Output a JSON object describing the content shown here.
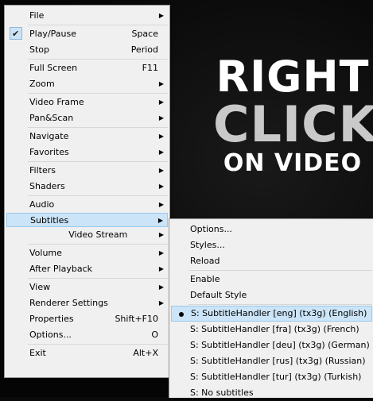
{
  "overlay": {
    "line1": "RIGHT",
    "line2": "CLICK",
    "line3": "ON VIDEO"
  },
  "main_menu": {
    "groups": [
      [
        {
          "label": "File",
          "submenu": true
        }
      ],
      [
        {
          "label": "Play/Pause",
          "shortcut": "Space",
          "checked": true
        },
        {
          "label": "Stop",
          "shortcut": "Period"
        }
      ],
      [
        {
          "label": "Full Screen",
          "shortcut": "F11"
        },
        {
          "label": "Zoom",
          "submenu": true
        }
      ],
      [
        {
          "label": "Video Frame",
          "submenu": true
        },
        {
          "label": "Pan&Scan",
          "submenu": true
        }
      ],
      [
        {
          "label": "Navigate",
          "submenu": true
        },
        {
          "label": "Favorites",
          "submenu": true
        }
      ],
      [
        {
          "label": "Filters",
          "submenu": true
        },
        {
          "label": "Shaders",
          "submenu": true
        }
      ],
      [
        {
          "label": "Audio",
          "submenu": true
        },
        {
          "label": "Subtitles",
          "submenu": true,
          "active": true
        },
        {
          "label": "Video Stream",
          "submenu": true
        }
      ],
      [
        {
          "label": "Volume",
          "submenu": true
        },
        {
          "label": "After Playback",
          "submenu": true
        }
      ],
      [
        {
          "label": "View",
          "submenu": true
        },
        {
          "label": "Renderer Settings",
          "submenu": true
        },
        {
          "label": "Properties",
          "shortcut": "Shift+F10"
        },
        {
          "label": "Options...",
          "shortcut": "O"
        }
      ],
      [
        {
          "label": "Exit",
          "shortcut": "Alt+X"
        }
      ]
    ]
  },
  "subtitles_menu": {
    "groups": [
      [
        {
          "label": "Options..."
        },
        {
          "label": "Styles..."
        },
        {
          "label": "Reload"
        }
      ],
      [
        {
          "label": "Enable"
        },
        {
          "label": "Default Style"
        }
      ],
      [
        {
          "label": "S: SubtitleHandler [eng] (tx3g) (English)",
          "selected": true
        },
        {
          "label": "S: SubtitleHandler [fra] (tx3g) (French)"
        },
        {
          "label": "S: SubtitleHandler [deu] (tx3g) (German)"
        },
        {
          "label": "S: SubtitleHandler [rus] (tx3g) (Russian)"
        },
        {
          "label": "S: SubtitleHandler [tur] (tx3g) (Turkish)"
        },
        {
          "label": "S: No subtitles"
        }
      ]
    ]
  },
  "icons": {
    "submenu_arrow": "▶",
    "check": "checkmark-icon",
    "bullet": "bullet-icon"
  },
  "colors": {
    "menu_bg": "#f0f0f0",
    "highlight": "#cce4f7",
    "highlight_border": "#99c9ef"
  }
}
